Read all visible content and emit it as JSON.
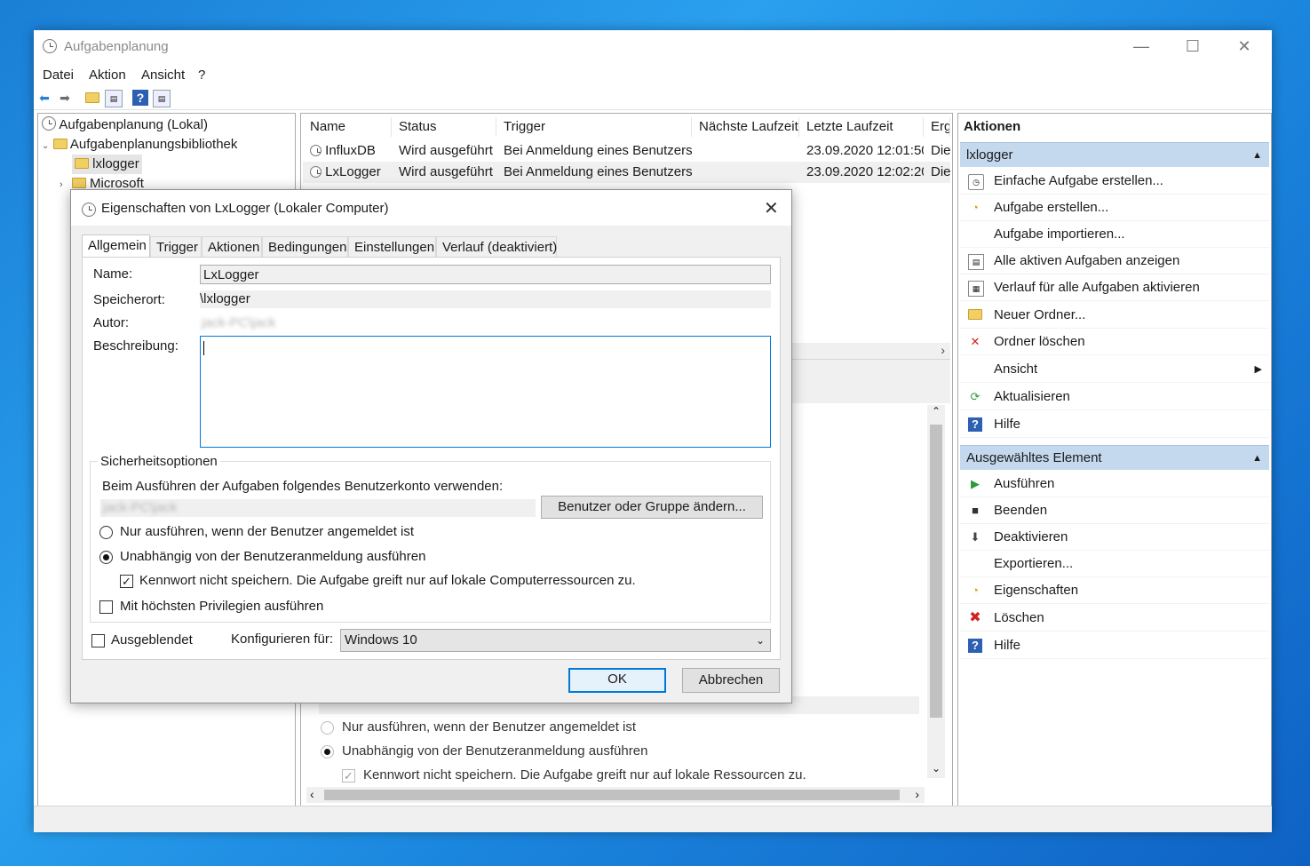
{
  "window": {
    "title": "Aufgabenplanung",
    "minimize": "—",
    "maximize": "☐",
    "close": "✕"
  },
  "menu": [
    "Datei",
    "Aktion",
    "Ansicht",
    "?"
  ],
  "tree": {
    "root": "Aufgabenplanung (Lokal)",
    "library": "Aufgabenplanungsbibliothek",
    "items": [
      "lxlogger",
      "Microsoft"
    ]
  },
  "task_list": {
    "columns": [
      "Name",
      "Status",
      "Trigger",
      "Nächste Laufzeit",
      "Letzte Laufzeit",
      "Erg"
    ],
    "rows": [
      {
        "name": "InfluxDB",
        "status": "Wird ausgeführt",
        "trigger": "Bei Anmeldung eines Benutzers",
        "next": "",
        "last": "23.09.2020 12:01:50",
        "result": "Die"
      },
      {
        "name": "LxLogger",
        "status": "Wird ausgeführt",
        "trigger": "Bei Anmeldung eines Benutzers",
        "next": "",
        "last": "23.09.2020 12:02:20",
        "result": "Die"
      }
    ]
  },
  "detail_background": {
    "radio1": "Nur ausführen, wenn der Benutzer angemeldet ist",
    "radio2": "Unabhängig von der Benutzeranmeldung ausführen",
    "check1": "Kennwort nicht speichern. Die Aufgabe greift nur auf lokale Ressourcen zu."
  },
  "actions": {
    "header": "Aktionen",
    "section1": "lxlogger",
    "section1_items": [
      "Einfache Aufgabe erstellen...",
      "Aufgabe erstellen...",
      "Aufgabe importieren...",
      "Alle aktiven Aufgaben anzeigen",
      "Verlauf für alle Aufgaben aktivieren",
      "Neuer Ordner...",
      "Ordner löschen",
      "Ansicht",
      "Aktualisieren",
      "Hilfe"
    ],
    "section2": "Ausgewähltes Element",
    "section2_items": [
      "Ausführen",
      "Beenden",
      "Deaktivieren",
      "Exportieren...",
      "Eigenschaften",
      "Löschen",
      "Hilfe"
    ]
  },
  "dialog": {
    "title": "Eigenschaften von LxLogger (Lokaler Computer)",
    "tabs": [
      "Allgemein",
      "Trigger",
      "Aktionen",
      "Bedingungen",
      "Einstellungen",
      "Verlauf (deaktiviert)"
    ],
    "name_label": "Name:",
    "name_value": "LxLogger",
    "location_label": "Speicherort:",
    "location_value": "\\lxlogger",
    "author_label": "Autor:",
    "author_value": "jack-PC\\jack",
    "description_label": "Beschreibung:",
    "security": {
      "legend": "Sicherheitsoptionen",
      "account_text": "Beim Ausführen der Aufgaben folgendes Benutzerkonto verwenden:",
      "account_value": "jack-PC\\jack",
      "change_button": "Benutzer oder Gruppe ändern...",
      "radio1": "Nur ausführen, wenn der Benutzer angemeldet ist",
      "radio2": "Unabhängig von der Benutzeranmeldung ausführen",
      "check_password": "Kennwort nicht speichern. Die Aufgabe greift nur auf lokale Computerressourcen zu.",
      "check_highest": "Mit höchsten Privilegien ausführen"
    },
    "hidden_label": "Ausgeblendet",
    "configure_label": "Konfigurieren für:",
    "configure_value": "Windows 10",
    "ok": "OK",
    "cancel": "Abbrechen"
  }
}
